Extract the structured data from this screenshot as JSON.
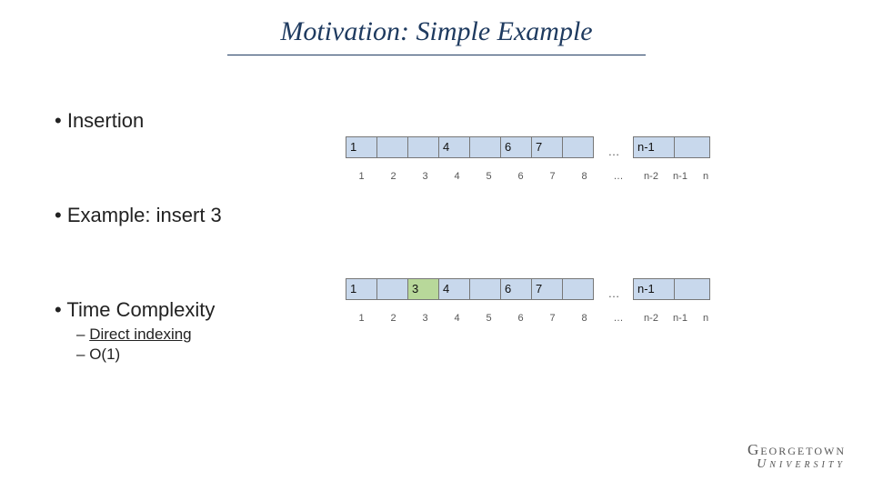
{
  "title": "Motivation: Simple Example",
  "bullets": {
    "b1": "Insertion",
    "b2": "Example: insert 3",
    "b3": "Time Complexity",
    "sub1": "Direct indexing",
    "sub2": "O(1)"
  },
  "array1": {
    "cells": [
      "1",
      "",
      "",
      "4",
      "",
      "6",
      "7",
      ""
    ],
    "end_label": "n-1",
    "indices": [
      "1",
      "2",
      "3",
      "4",
      "5",
      "6",
      "7",
      "8"
    ],
    "indices_end": [
      "n-2",
      "n-1",
      "n"
    ],
    "ellipsis": "…"
  },
  "array2": {
    "cells_pre": [
      "1",
      ""
    ],
    "hi": "3",
    "cells_post": [
      "4",
      "",
      "6",
      "7",
      ""
    ],
    "end_label": "n-1",
    "indices": [
      "1",
      "2",
      "3",
      "4",
      "5",
      "6",
      "7",
      "8"
    ],
    "indices_end": [
      "n-2",
      "n-1",
      "n"
    ],
    "ellipsis": "…"
  },
  "logo": {
    "top": "Georgetown",
    "bottom": "University"
  }
}
